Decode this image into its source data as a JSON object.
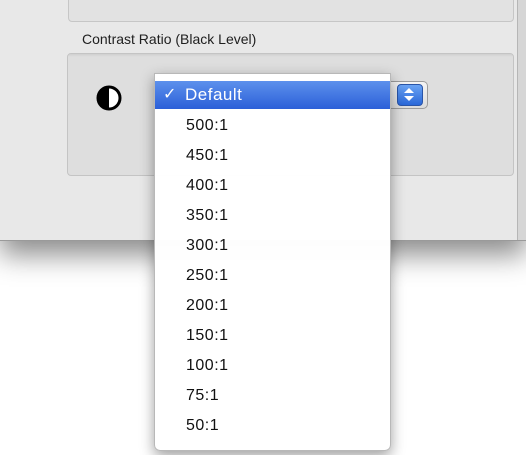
{
  "section": {
    "title": "Contrast Ratio (Black Level)"
  },
  "popup": {
    "selected_value": "Default",
    "checkmark": "✓"
  },
  "menu": {
    "items": [
      {
        "label": "Default",
        "selected": true
      },
      {
        "label": "500:1",
        "selected": false
      },
      {
        "label": "450:1",
        "selected": false
      },
      {
        "label": "400:1",
        "selected": false
      },
      {
        "label": "350:1",
        "selected": false
      },
      {
        "label": "300:1",
        "selected": false
      },
      {
        "label": "250:1",
        "selected": false
      },
      {
        "label": "200:1",
        "selected": false
      },
      {
        "label": "150:1",
        "selected": false
      },
      {
        "label": "100:1",
        "selected": false
      },
      {
        "label": "75:1",
        "selected": false
      },
      {
        "label": "50:1",
        "selected": false
      }
    ]
  },
  "icons": {
    "contrast": "contrast-icon",
    "stepper": "popup-stepper-icon",
    "check": "checkmark-icon"
  },
  "colors": {
    "highlight_top": "#5d91ec",
    "highlight_bottom": "#2b5fd8",
    "window_bg": "#e8e8e8",
    "group_bg": "#dedede"
  }
}
